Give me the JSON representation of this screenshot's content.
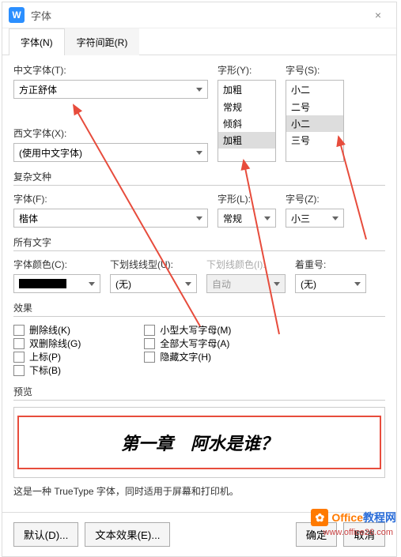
{
  "dialog": {
    "title": "字体",
    "close": "×"
  },
  "tabs": [
    {
      "label": "字体(N)",
      "active": true
    },
    {
      "label": "字符间距(R)",
      "active": false
    }
  ],
  "chineseFont": {
    "label": "中文字体(T):",
    "value": "方正舒体"
  },
  "style": {
    "label": "字形(Y):",
    "value": "加粗",
    "options": [
      "常规",
      "倾斜",
      "加粗"
    ]
  },
  "size": {
    "label": "字号(S):",
    "value": "小二",
    "options": [
      "二号",
      "小二",
      "三号"
    ]
  },
  "westernFont": {
    "label": "西文字体(X):",
    "value": "(使用中文字体)"
  },
  "complex": {
    "header": "复杂文种",
    "fontLabel": "字体(F):",
    "fontValue": "楷体",
    "styleLabel": "字形(L):",
    "styleValue": "常规",
    "sizeLabel": "字号(Z):",
    "sizeValue": "小三"
  },
  "allText": {
    "header": "所有文字",
    "colorLabel": "字体颜色(C):",
    "underlineLabel": "下划线线型(U):",
    "underlineValue": "(无)",
    "underlineColorLabel": "下划线颜色(I):",
    "underlineColorValue": "自动",
    "emphasisLabel": "着重号:",
    "emphasisValue": "(无)"
  },
  "effects": {
    "header": "效果",
    "left": [
      "删除线(K)",
      "双删除线(G)",
      "上标(P)",
      "下标(B)"
    ],
    "right": [
      "小型大写字母(M)",
      "全部大写字母(A)",
      "隐藏文字(H)"
    ]
  },
  "preview": {
    "header": "预览",
    "text": "第一章　阿水是谁？"
  },
  "note": "这是一种 TrueType 字体，同时适用于屏幕和打印机。",
  "footer": {
    "default": "默认(D)...",
    "textEffect": "文本效果(E)...",
    "ok": "确定",
    "cancel": "取消"
  },
  "watermark": {
    "brand": "Office教程网",
    "url": "www.office26.com"
  }
}
